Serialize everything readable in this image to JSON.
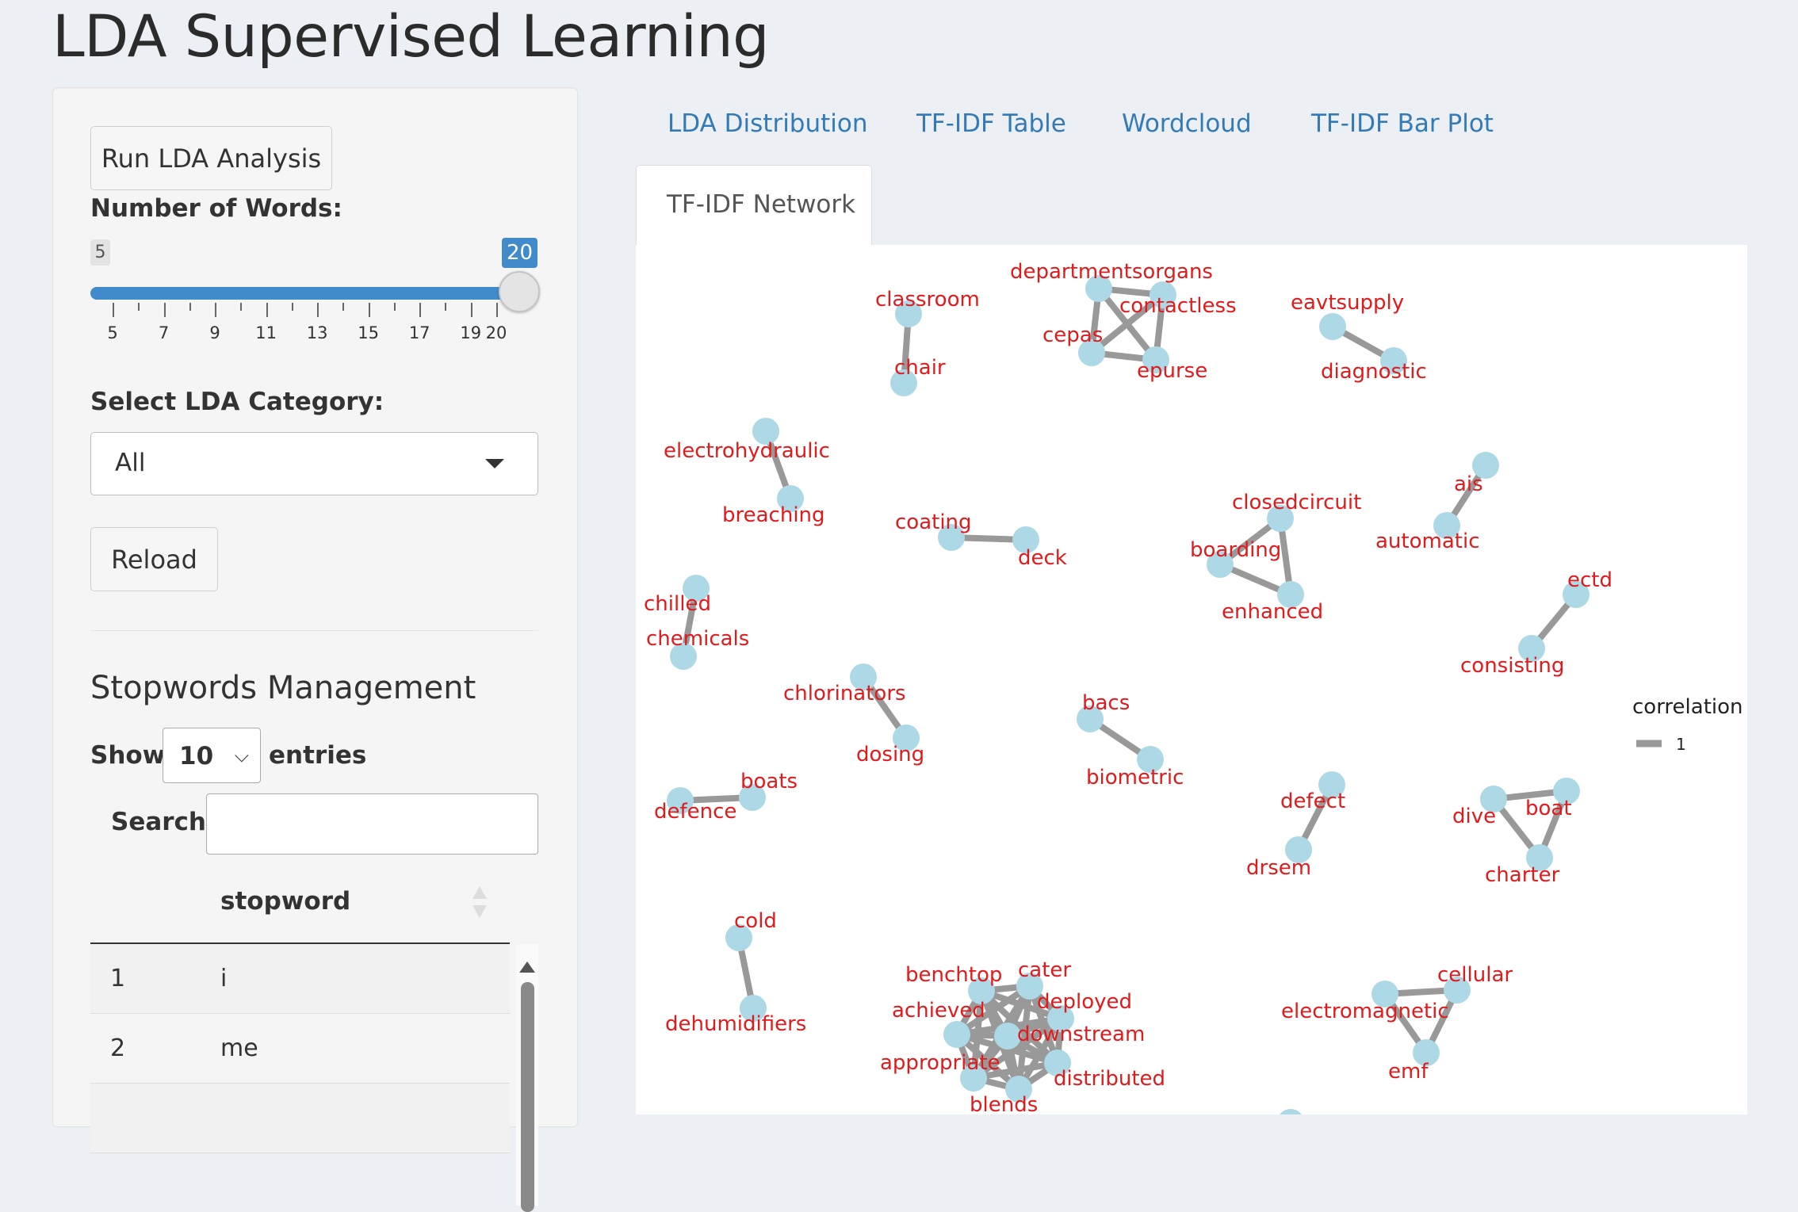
{
  "app": {
    "title": "LDA Supervised Learning"
  },
  "sidebar": {
    "run_button": "Run LDA Analysis",
    "num_words_label": "Number of Words:",
    "slider": {
      "min": 5,
      "max": 20,
      "value": 20,
      "min_label": "5",
      "value_label": "20",
      "ticks": [
        "5",
        "7",
        "9",
        "11",
        "13",
        "15",
        "17",
        "19",
        "20"
      ]
    },
    "category_label": "Select LDA Category:",
    "category_value": "All",
    "reload_button": "Reload",
    "stopwords": {
      "title": "Stopwords Management",
      "show_label": "Show",
      "entries_value": "10",
      "entries_label": "entries",
      "search_label": "Search:",
      "column_header": "stopword",
      "rows": [
        {
          "num": "1",
          "word": "i"
        },
        {
          "num": "2",
          "word": "me"
        }
      ]
    }
  },
  "tabs": [
    {
      "label": "LDA Distribution"
    },
    {
      "label": "TF-IDF Table"
    },
    {
      "label": "Wordcloud"
    },
    {
      "label": "TF-IDF Bar Plot"
    }
  ],
  "active_tab": {
    "label": "TF-IDF Network"
  },
  "network": {
    "legend": {
      "title": "correlation",
      "value": "1"
    },
    "colors": {
      "node": "#add8e6",
      "edge": "#999999",
      "label": "#e31a1c"
    },
    "nodes": [
      {
        "id": "classroom",
        "label": "classroom"
      },
      {
        "id": "chair",
        "label": "chair"
      },
      {
        "id": "departmentsorgans",
        "label": "departmentsorgans"
      },
      {
        "id": "contactless",
        "label": "contactless"
      },
      {
        "id": "cepas",
        "label": "cepas"
      },
      {
        "id": "epurse",
        "label": "epurse"
      },
      {
        "id": "eavtsupply",
        "label": "eavtsupply"
      },
      {
        "id": "diagnostic",
        "label": "diagnostic"
      },
      {
        "id": "electrohydraulic",
        "label": "electrohydraulic"
      },
      {
        "id": "breaching",
        "label": "breaching"
      },
      {
        "id": "coating",
        "label": "coating"
      },
      {
        "id": "deck",
        "label": "deck"
      },
      {
        "id": "closedcircuit",
        "label": "closedcircuit"
      },
      {
        "id": "boarding",
        "label": "boarding"
      },
      {
        "id": "enhanced",
        "label": "enhanced"
      },
      {
        "id": "ais",
        "label": "ais"
      },
      {
        "id": "automatic",
        "label": "automatic"
      },
      {
        "id": "ectd",
        "label": "ectd"
      },
      {
        "id": "consisting",
        "label": "consisting"
      },
      {
        "id": "chilled",
        "label": "chilled"
      },
      {
        "id": "chemicals",
        "label": "chemicals"
      },
      {
        "id": "chlorinators",
        "label": "chlorinators"
      },
      {
        "id": "dosing",
        "label": "dosing"
      },
      {
        "id": "bacs",
        "label": "bacs"
      },
      {
        "id": "biometric",
        "label": "biometric"
      },
      {
        "id": "boats",
        "label": "boats"
      },
      {
        "id": "defence",
        "label": "defence"
      },
      {
        "id": "defect",
        "label": "defect"
      },
      {
        "id": "drsem",
        "label": "drsem"
      },
      {
        "id": "dive",
        "label": "dive"
      },
      {
        "id": "boat",
        "label": "boat"
      },
      {
        "id": "charter",
        "label": "charter"
      },
      {
        "id": "cold",
        "label": "cold"
      },
      {
        "id": "dehumidifiers",
        "label": "dehumidifiers"
      },
      {
        "id": "benchtop",
        "label": "benchtop"
      },
      {
        "id": "cater",
        "label": "cater"
      },
      {
        "id": "deployed",
        "label": "deployed"
      },
      {
        "id": "achieved",
        "label": "achieved"
      },
      {
        "id": "downstream",
        "label": "downstream"
      },
      {
        "id": "appropriate",
        "label": "appropriate"
      },
      {
        "id": "distributed",
        "label": "distributed"
      },
      {
        "id": "blends",
        "label": "blends"
      },
      {
        "id": "cellular",
        "label": "cellular"
      },
      {
        "id": "electromagnetic",
        "label": "electromagnetic"
      },
      {
        "id": "emf",
        "label": "emf"
      }
    ],
    "edges": [
      [
        "classroom",
        "chair"
      ],
      [
        "departmentsorgans",
        "contactless"
      ],
      [
        "departmentsorgans",
        "cepas"
      ],
      [
        "departmentsorgans",
        "epurse"
      ],
      [
        "contactless",
        "cepas"
      ],
      [
        "contactless",
        "epurse"
      ],
      [
        "cepas",
        "epurse"
      ],
      [
        "eavtsupply",
        "diagnostic"
      ],
      [
        "electrohydraulic",
        "breaching"
      ],
      [
        "coating",
        "deck"
      ],
      [
        "closedcircuit",
        "boarding"
      ],
      [
        "closedcircuit",
        "enhanced"
      ],
      [
        "boarding",
        "enhanced"
      ],
      [
        "ais",
        "automatic"
      ],
      [
        "ectd",
        "consisting"
      ],
      [
        "chilled",
        "chemicals"
      ],
      [
        "chlorinators",
        "dosing"
      ],
      [
        "bacs",
        "biometric"
      ],
      [
        "boats",
        "defence"
      ],
      [
        "defect",
        "drsem"
      ],
      [
        "dive",
        "boat"
      ],
      [
        "dive",
        "charter"
      ],
      [
        "boat",
        "charter"
      ],
      [
        "cold",
        "dehumidifiers"
      ],
      [
        "benchtop",
        "cater"
      ],
      [
        "benchtop",
        "deployed"
      ],
      [
        "benchtop",
        "achieved"
      ],
      [
        "benchtop",
        "downstream"
      ],
      [
        "benchtop",
        "appropriate"
      ],
      [
        "benchtop",
        "distributed"
      ],
      [
        "benchtop",
        "blends"
      ],
      [
        "cater",
        "deployed"
      ],
      [
        "cater",
        "achieved"
      ],
      [
        "cater",
        "downstream"
      ],
      [
        "cater",
        "appropriate"
      ],
      [
        "cater",
        "distributed"
      ],
      [
        "cater",
        "blends"
      ],
      [
        "deployed",
        "achieved"
      ],
      [
        "deployed",
        "downstream"
      ],
      [
        "deployed",
        "appropriate"
      ],
      [
        "deployed",
        "distributed"
      ],
      [
        "deployed",
        "blends"
      ],
      [
        "achieved",
        "downstream"
      ],
      [
        "achieved",
        "appropriate"
      ],
      [
        "achieved",
        "distributed"
      ],
      [
        "achieved",
        "blends"
      ],
      [
        "downstream",
        "appropriate"
      ],
      [
        "downstream",
        "distributed"
      ],
      [
        "downstream",
        "blends"
      ],
      [
        "appropriate",
        "distributed"
      ],
      [
        "appropriate",
        "blends"
      ],
      [
        "distributed",
        "blends"
      ],
      [
        "cellular",
        "electromagnetic"
      ],
      [
        "cellular",
        "emf"
      ],
      [
        "electromagnetic",
        "emf"
      ]
    ]
  }
}
